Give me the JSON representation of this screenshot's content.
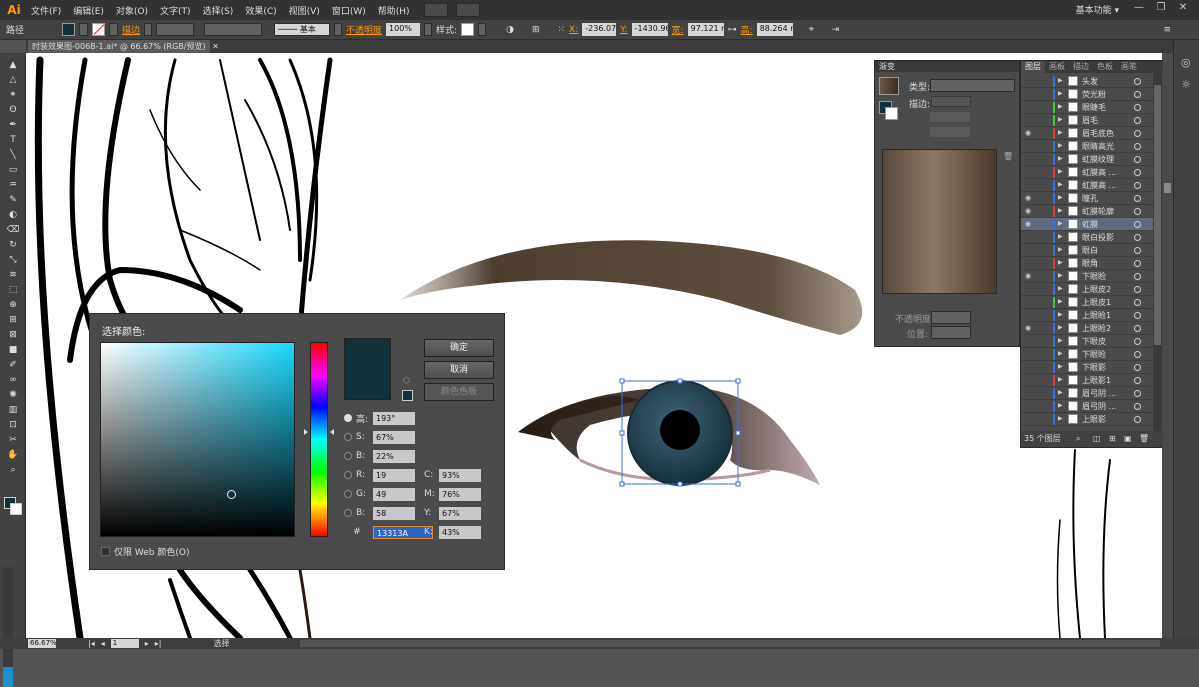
{
  "app": {
    "logo": "Ai",
    "workspace": "基本功能",
    "workspace_arrow": "▾"
  },
  "menu": [
    "文件(F)",
    "编辑(E)",
    "对象(O)",
    "文字(T)",
    "选择(S)",
    "效果(C)",
    "视图(V)",
    "窗口(W)",
    "帮助(H)"
  ],
  "window_buttons": {
    "min": "—",
    "max": "❐",
    "close": "✕"
  },
  "control": {
    "path_label": "路径",
    "fill_color": "#13313a",
    "stroke_label": "描边",
    "stroke_style": "基本",
    "opacity_label": "不透明度",
    "opacity_value": "100%",
    "style_label": "样式:",
    "x_label": "X:",
    "x_value": "-236.078",
    "y_label": "Y:",
    "y_value": "-1430.96",
    "w_label": "宽:",
    "w_value": "97.121 m",
    "h_label": "高:",
    "h_value": "88.264 m"
  },
  "document": {
    "tab_title": "时装效果图-006B-1.ai* @ 66.67% (RGB/预览)",
    "tab_close": "✕"
  },
  "tools_icons": [
    "selection-icon",
    "direct-selection-icon",
    "magic-wand-icon",
    "lasso-icon",
    "pen-icon",
    "type-icon",
    "line-icon",
    "rectangle-icon",
    "paintbrush-icon",
    "pencil-icon",
    "blob-brush-icon",
    "eraser-icon",
    "rotate-icon",
    "scale-icon",
    "width-icon",
    "free-transform-icon",
    "shape-builder-icon",
    "perspective-icon",
    "mesh-icon",
    "gradient-icon",
    "eyedropper-icon",
    "blend-icon",
    "symbol-sprayer-icon",
    "graph-icon",
    "artboard-icon",
    "slice-icon",
    "hand-icon",
    "zoom-icon"
  ],
  "tool_glyphs": [
    "▲",
    "△",
    "✴",
    "ʘ",
    "✒",
    "T",
    "╲",
    "▭",
    "♒",
    "✎",
    "◐",
    "⌫",
    "↻",
    "⤡",
    "≋",
    "⬚",
    "⊕",
    "⊞",
    "⊠",
    "■",
    "✐",
    "∞",
    "✺",
    "▥",
    "⊡",
    "✂",
    "✋",
    "⌕"
  ],
  "status": {
    "zoom": "66.67%",
    "page": "1",
    "mode": "选择"
  },
  "color_picker": {
    "title": "选择颜色:",
    "ok": "确定",
    "cancel": "取消",
    "swatches": "颜色色板",
    "color": "#13313a",
    "h_label": "高:",
    "h_value": "193°",
    "s_label": "S:",
    "s_value": "67%",
    "b_label": "B:",
    "b_value": "22%",
    "r_label": "R:",
    "r_value": "19",
    "g_label": "G:",
    "g_value": "49",
    "bb_label": "B:",
    "bb_value": "58",
    "hex_label": "#",
    "hex_value": "13313A",
    "c_label": "C:",
    "c_value": "93%",
    "m_label": "M:",
    "m_value": "76%",
    "y_label": "Y:",
    "y_value": "67%",
    "k_label": "K:",
    "k_value": "43%",
    "web_only": "仅限 Web 颜色(O)"
  },
  "gradient_panel": {
    "tab": "渐变",
    "type_label": "类型:",
    "stroke_label": "描边:",
    "opacity_label": "不透明度:",
    "position_label": "位置:",
    "stop_left": "#5a4a3c",
    "stop_right": "#4a3a2c"
  },
  "layers_panel": {
    "tabs": [
      "图层",
      "画板",
      "描边",
      "色板",
      "画笔"
    ],
    "footer": "35 个图层",
    "rows": [
      {
        "name": "头发",
        "color": "#3c6ee0",
        "eye": "",
        "selected": false
      },
      {
        "name": "荧光粉",
        "color": "#3c6ee0",
        "eye": "",
        "selected": false
      },
      {
        "name": "眼睫毛",
        "color": "#3ccb3c",
        "eye": "",
        "selected": false
      },
      {
        "name": "眉毛",
        "color": "#3ccb3c",
        "eye": "",
        "selected": false
      },
      {
        "name": "眉毛底色",
        "color": "#e03c3c",
        "eye": "◉",
        "selected": false
      },
      {
        "name": "眼睛高光",
        "color": "#3c6ee0",
        "eye": "",
        "selected": false
      },
      {
        "name": "虹膜纹理",
        "color": "#3c6ee0",
        "eye": "",
        "selected": false
      },
      {
        "name": "虹膜高 ...",
        "color": "#e03c3c",
        "eye": "",
        "selected": false
      },
      {
        "name": "虹膜高 ...",
        "color": "#3c6ee0",
        "eye": "",
        "selected": false
      },
      {
        "name": "瞳孔",
        "color": "#3c6ee0",
        "eye": "◉",
        "selected": false
      },
      {
        "name": "虹膜轮廓",
        "color": "#e03c3c",
        "eye": "◉",
        "selected": false
      },
      {
        "name": "虹膜",
        "color": "#3c6ee0",
        "eye": "◉",
        "selected": true
      },
      {
        "name": "眼白投影",
        "color": "#3c6ee0",
        "eye": "",
        "selected": false
      },
      {
        "name": "眼白",
        "color": "#3c6ee0",
        "eye": "",
        "selected": false
      },
      {
        "name": "眼角",
        "color": "#e03c3c",
        "eye": "",
        "selected": false
      },
      {
        "name": "下眼睑",
        "color": "#3c6ee0",
        "eye": "◉",
        "selected": false
      },
      {
        "name": "上眼皮2",
        "color": "#3c6ee0",
        "eye": "",
        "selected": false
      },
      {
        "name": "上眼皮1",
        "color": "#3ccb3c",
        "eye": "",
        "selected": false
      },
      {
        "name": "上眼睑1",
        "color": "#3c6ee0",
        "eye": "",
        "selected": false
      },
      {
        "name": "上眼睑2",
        "color": "#3c6ee0",
        "eye": "◉",
        "selected": false
      },
      {
        "name": "下眼皮",
        "color": "#3c6ee0",
        "eye": "",
        "selected": false
      },
      {
        "name": "下眼睑",
        "color": "#3c6ee0",
        "eye": "",
        "selected": false
      },
      {
        "name": "下眼影",
        "color": "#3c6ee0",
        "eye": "",
        "selected": false
      },
      {
        "name": "上眼影1",
        "color": "#e03c3c",
        "eye": "",
        "selected": false
      },
      {
        "name": "眉弓阴 ...",
        "color": "#3c6ee0",
        "eye": "",
        "selected": false
      },
      {
        "name": "眉弓阴 ...",
        "color": "#3c6ee0",
        "eye": "",
        "selected": false
      },
      {
        "name": "上眼影",
        "color": "#3c6ee0",
        "eye": "",
        "selected": false
      }
    ]
  }
}
